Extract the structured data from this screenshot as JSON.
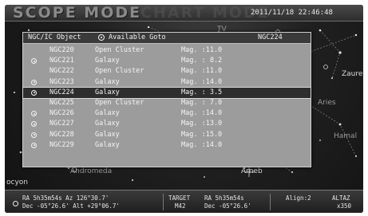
{
  "header": {
    "mode_title": "SCOPE MODE",
    "ghost_title": "CHART MODE",
    "datetime": "2011/11/18 22:46:48"
  },
  "sky": {
    "labels": [
      "TV",
      "Zaure",
      "Andromeda",
      "Aries",
      "Hamal",
      "Arneb",
      "ocyon"
    ]
  },
  "dialog": {
    "catalog_label": "NGC/IC Object",
    "filter_label": "Available Goto",
    "current_object": "NGC224",
    "rows": [
      {
        "id": "NGC220",
        "type": "Open Cluster",
        "mag": "Mag. :11.0",
        "marked": false,
        "selected": false
      },
      {
        "id": "NGC221",
        "type": "Galaxy",
        "mag": "Mag. : 8.2",
        "marked": true,
        "selected": false
      },
      {
        "id": "NGC222",
        "type": "Open Cluster",
        "mag": "Mag. :11.0",
        "marked": false,
        "selected": false
      },
      {
        "id": "NGC223",
        "type": "Galaxy",
        "mag": "Mag. :14.0",
        "marked": true,
        "selected": false
      },
      {
        "id": "NGC224",
        "type": "Galaxy",
        "mag": "Mag. : 3.5",
        "marked": true,
        "selected": true
      },
      {
        "id": "NGC225",
        "type": "Open Cluster",
        "mag": "Mag. : 7.0",
        "marked": false,
        "selected": false
      },
      {
        "id": "NGC226",
        "type": "Galaxy",
        "mag": "Mag. :14.0",
        "marked": true,
        "selected": false
      },
      {
        "id": "NGC227",
        "type": "Galaxy",
        "mag": "Mag. :13.0",
        "marked": true,
        "selected": false
      },
      {
        "id": "NGC228",
        "type": "Galaxy",
        "mag": "Mag. :15.0",
        "marked": true,
        "selected": false
      },
      {
        "id": "NGC229",
        "type": "Galaxy",
        "mag": "Mag. :14.0",
        "marked": true,
        "selected": false
      }
    ]
  },
  "status": {
    "ra_line": "RA  5h35m54s  Az 126°30.7'",
    "dec_line": "Dec -05°26.6'  Alt +29°06.7'",
    "target_label": "TARGET",
    "target_value": "M42",
    "target_ra": "RA  5h35m54s",
    "target_dec": "Dec -05°26.6'",
    "align_label": "Align:2",
    "mode_label": "ALTAZ",
    "zoom_label": "x350"
  },
  "colors": {
    "screen_bg": "#1f1f1f",
    "dialog_bg": "#9c9c9c",
    "selected_row": "#2e2e2e",
    "text": "#f4f4f4"
  }
}
